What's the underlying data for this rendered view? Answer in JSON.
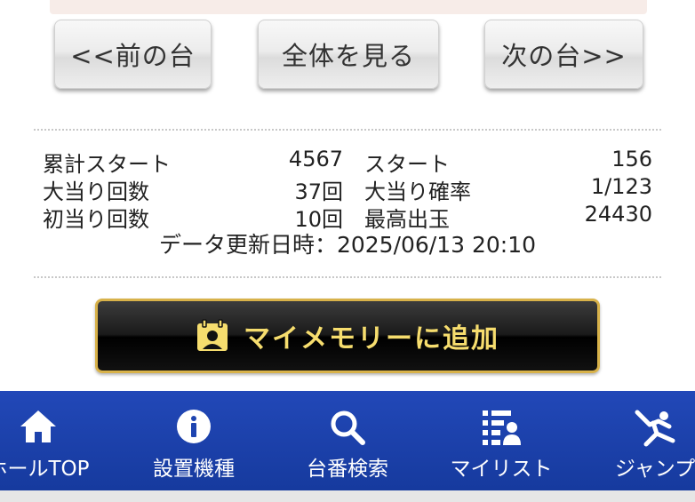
{
  "nav_buttons": {
    "prev": "<<前の台",
    "all": "全体を見る",
    "next": "次の台>>"
  },
  "stats": {
    "rows": [
      {
        "label1": "累計スタート",
        "value1": "4567",
        "label2": "スタート",
        "value2": "156"
      },
      {
        "label1": "大当り回数",
        "value1": "37回",
        "label2": "大当り確率",
        "value2": "1/123"
      },
      {
        "label1": "初当り回数",
        "value1": "10回",
        "label2": "最高出玉",
        "value2": "24430"
      }
    ],
    "updated": "データ更新日時：2025/06/13 20:10"
  },
  "memory_button": {
    "label": "マイメモリーに追加",
    "icon": "memory-icon",
    "text_color": "#f6dd6e",
    "border_color": "#d8b24a"
  },
  "bottom_nav": {
    "color": "#1e44b0",
    "items": [
      {
        "label": "ホールTOP",
        "icon": "home-icon"
      },
      {
        "label": "設置機種",
        "icon": "info-icon"
      },
      {
        "label": "台番検索",
        "icon": "search-icon"
      },
      {
        "label": "マイリスト",
        "icon": "mylist-icon"
      },
      {
        "label": "ジャンプ",
        "icon": "jump-icon"
      }
    ]
  }
}
